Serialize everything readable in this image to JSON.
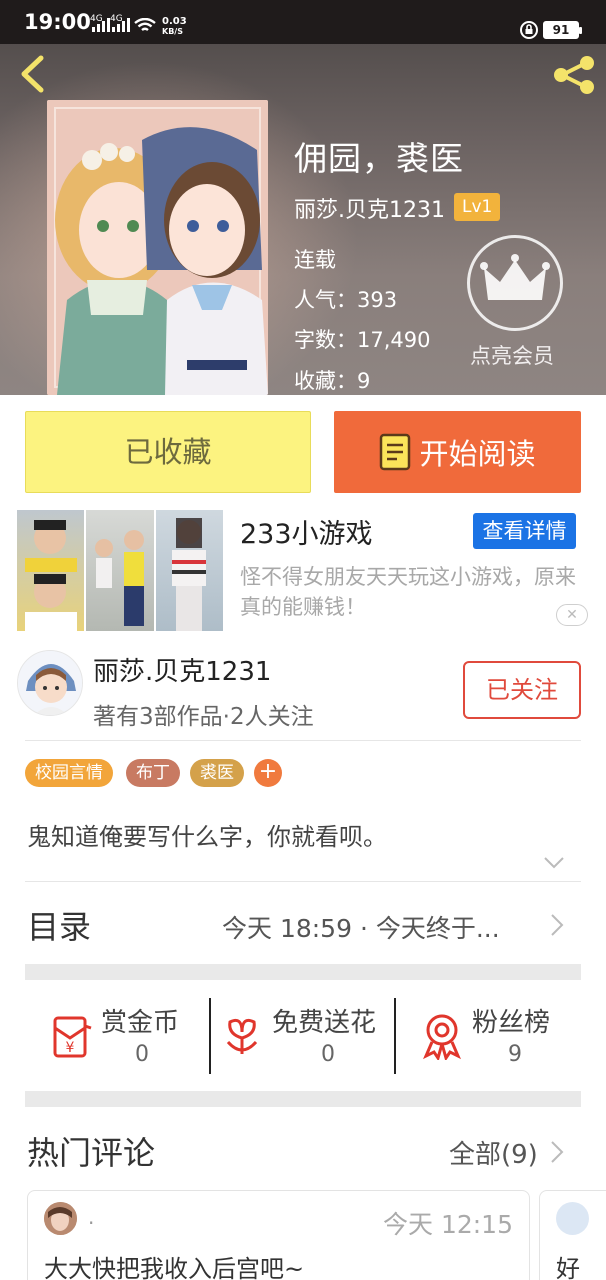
{
  "status_bar": {
    "time": "19:00",
    "network_1": "4G",
    "network_2": "4G",
    "speed_value": "0.03",
    "speed_unit": "KB/S",
    "battery": "91"
  },
  "book": {
    "title": "佣园，裘医",
    "author": "丽莎.贝克1231",
    "level": "Lv1",
    "status": "连载",
    "popularity_label": "人气：",
    "popularity": "393",
    "words_label": "字数：",
    "words": "17,490",
    "favorites_label": "收藏：",
    "favorites": "9",
    "vip_label": "点亮会员"
  },
  "actions": {
    "collected_label": "已收藏",
    "read_label": "开始阅读"
  },
  "ad": {
    "title": "233小游戏",
    "detail_label": "查看详情",
    "description": "怪不得女朋友天天玩这小游戏，原来真的能赚钱！",
    "close_label": "✕"
  },
  "author_section": {
    "name": "丽莎.贝克1231",
    "meta": "著有3部作品·2人关注",
    "follow_label": "已关注"
  },
  "tags": [
    {
      "label": "校园言情",
      "color": "#f2a53a"
    },
    {
      "label": "布丁",
      "color": "#c87a62"
    },
    {
      "label": "裘医",
      "color": "#d4a14a"
    }
  ],
  "tag_more": "+",
  "intro": "鬼知道俺要写什么字，你就看呗。",
  "catalog": {
    "title": "目录",
    "update": "今天 18:59 · 今天终于..."
  },
  "stats": [
    {
      "label": "赏金币",
      "value": "0",
      "icon": "red-envelope-icon"
    },
    {
      "label": "免费送花",
      "value": "0",
      "icon": "flower-icon"
    },
    {
      "label": "粉丝榜",
      "value": "9",
      "icon": "medal-icon"
    }
  ],
  "comments": {
    "title": "热门评论",
    "all_label": "全部(9)",
    "items": [
      {
        "user": ".",
        "time": "今天 12:15",
        "text": "大大快把我收入后宫吧~"
      },
      {
        "user": "",
        "time": "",
        "text": "好"
      }
    ]
  },
  "colors": {
    "accent_orange": "#f06a3b",
    "collected_yellow": "#fcf380",
    "follow_red": "#e04a3c",
    "ad_blue": "#1b73e5",
    "level_badge": "#f2b33c"
  }
}
